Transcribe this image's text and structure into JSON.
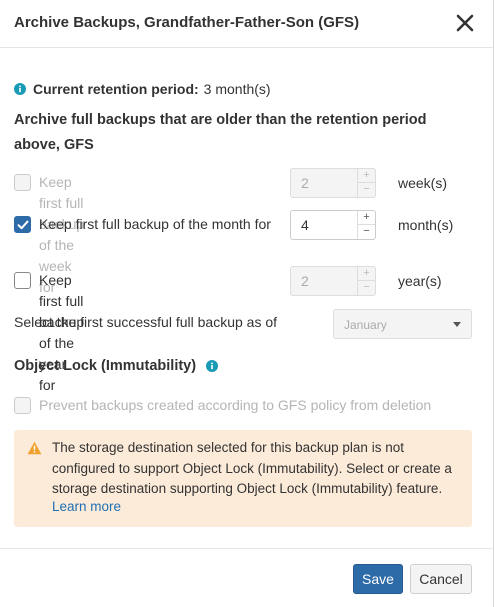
{
  "dialog": {
    "title": "Archive Backups, Grandfather-Father-Son (GFS)",
    "close_icon": "close-icon"
  },
  "retention": {
    "label": "Current retention period:",
    "value": "3 month(s)"
  },
  "section_heading": "Archive full backups that are older than the retention period above, GFS",
  "options": [
    {
      "label": "Keep first full backup of the week for",
      "checked": false,
      "disabled": true,
      "value": "2",
      "unit": "week(s)"
    },
    {
      "label": "Keep first full backup of the month for",
      "checked": true,
      "disabled": false,
      "value": "4",
      "unit": "month(s)"
    },
    {
      "label": "Keep first full backup of the year for",
      "checked": false,
      "disabled": false,
      "value": "2",
      "unit": "year(s)"
    }
  ],
  "stepper_up": "+",
  "stepper_down": "−",
  "first_backup": {
    "label": "Select the first successful full backup as of",
    "selected": "January"
  },
  "object_lock": {
    "heading": "Object Lock (Immutability)",
    "checkbox_label": "Prevent backups created according to GFS policy from deletion"
  },
  "warning": {
    "text": "The storage destination selected for this backup plan is not configured to support Object Lock (Immutability). Select or create a storage destination supporting Object Lock (Immutability) feature.",
    "link": "Learn more"
  },
  "footer": {
    "save": "Save",
    "cancel": "Cancel"
  },
  "colors": {
    "accent": "#2d6aa8",
    "info": "#1a9bb5",
    "warning_bg": "#fcebd9",
    "warning_icon": "#f0a22e",
    "link": "#1f6fb5"
  }
}
